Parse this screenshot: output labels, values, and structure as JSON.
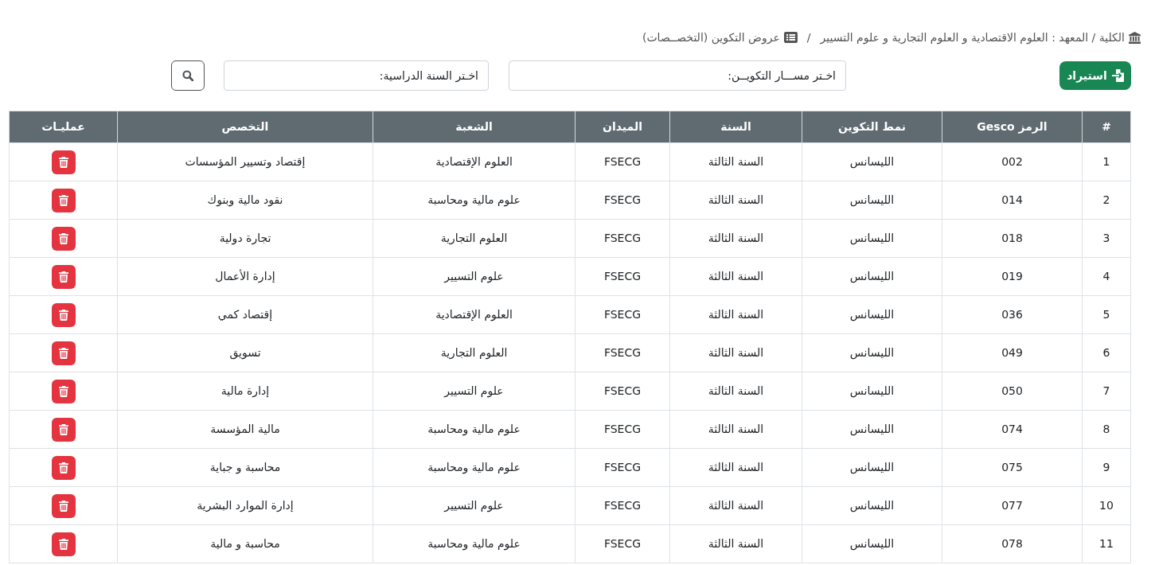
{
  "breadcrumb": {
    "items": [
      "الكلية / المعهد : العلوم الاقتصادية و العلوم التجارية و علوم التسيير",
      "عروض التكوين (التخصــصات)"
    ],
    "separator": "/"
  },
  "toolbar": {
    "import_button": "استيراد",
    "path_select": {
      "value": "اخـتر مســـار التكويــن:"
    },
    "year_select": {
      "value": "اخـتر السنة الدراسية:"
    }
  },
  "table": {
    "columns": [
      "#",
      "الرمز Gesco",
      "نمط التكوين",
      "السنة",
      "الميدان",
      "الشعبة",
      "التخصص",
      "عمليـات"
    ],
    "rows": [
      [
        "1",
        "002",
        "الليسانس",
        "السنة الثالثة",
        "FSECG",
        "العلوم الإقتصادية",
        "إقتصاد وتسيير المؤسسات"
      ],
      [
        "2",
        "014",
        "الليسانس",
        "السنة الثالثة",
        "FSECG",
        "علوم مالية ومحاسبة",
        "نقود مالية وبنوك"
      ],
      [
        "3",
        "018",
        "الليسانس",
        "السنة الثالثة",
        "FSECG",
        "العلوم التجارية",
        "تجارة دولية"
      ],
      [
        "4",
        "019",
        "الليسانس",
        "السنة الثالثة",
        "FSECG",
        "علوم التسيير",
        "إدارة الأعمال"
      ],
      [
        "5",
        "036",
        "الليسانس",
        "السنة الثالثة",
        "FSECG",
        "العلوم الإقتصادية",
        "إقتصاد كمي"
      ],
      [
        "6",
        "049",
        "الليسانس",
        "السنة الثالثة",
        "FSECG",
        "العلوم التجارية",
        "تسويق"
      ],
      [
        "7",
        "050",
        "الليسانس",
        "السنة الثالثة",
        "FSECG",
        "علوم التسيير",
        "إدارة مالية"
      ],
      [
        "8",
        "074",
        "الليسانس",
        "السنة الثالثة",
        "FSECG",
        "علوم مالية ومحاسبة",
        "مالية المؤسسة"
      ],
      [
        "9",
        "075",
        "الليسانس",
        "السنة الثالثة",
        "FSECG",
        "علوم مالية ومحاسبة",
        "محاسبة و جباية"
      ],
      [
        "10",
        "077",
        "الليسانس",
        "السنة الثالثة",
        "FSECG",
        "علوم التسيير",
        "إدارة الموارد البشرية"
      ],
      [
        "11",
        "078",
        "الليسانس",
        "السنة الثالثة",
        "FSECG",
        "علوم مالية ومحاسبة",
        "محاسبة و مالية"
      ]
    ]
  }
}
